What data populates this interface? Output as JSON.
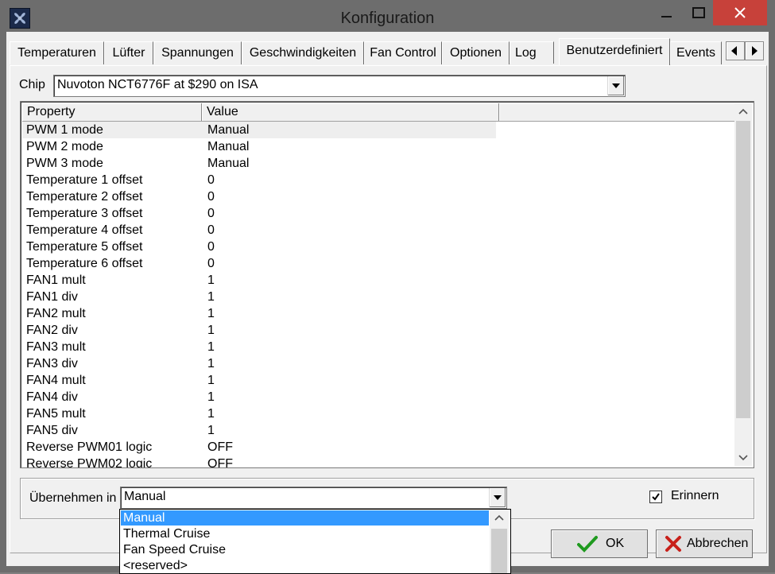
{
  "window": {
    "title": "Konfiguration",
    "close_color": "#c7413a"
  },
  "tabs": [
    {
      "label": "Temperaturen"
    },
    {
      "label": "Lüfter"
    },
    {
      "label": "Spannungen"
    },
    {
      "label": "Geschwindigkeiten"
    },
    {
      "label": "Fan Control"
    },
    {
      "label": "Optionen"
    },
    {
      "label": "Log"
    },
    {
      "label": "Benutzerdefiniert",
      "active": true
    },
    {
      "label": "Events"
    }
  ],
  "chip": {
    "label": "Chip",
    "value": "Nuvoton NCT6776F at $290 on ISA"
  },
  "grid": {
    "columns": [
      "Property",
      "Value"
    ],
    "rows": [
      {
        "property": "PWM 1 mode",
        "value": "Manual"
      },
      {
        "property": "PWM 2 mode",
        "value": "Manual"
      },
      {
        "property": "PWM 3 mode",
        "value": "Manual"
      },
      {
        "property": "Temperature 1 offset",
        "value": "0"
      },
      {
        "property": "Temperature 2 offset",
        "value": "0"
      },
      {
        "property": "Temperature 3 offset",
        "value": "0"
      },
      {
        "property": "Temperature 4 offset",
        "value": "0"
      },
      {
        "property": "Temperature 5 offset",
        "value": "0"
      },
      {
        "property": "Temperature 6 offset",
        "value": "0"
      },
      {
        "property": "FAN1 mult",
        "value": "1"
      },
      {
        "property": "FAN1 div",
        "value": "1"
      },
      {
        "property": "FAN2 mult",
        "value": "1"
      },
      {
        "property": "FAN2 div",
        "value": "1"
      },
      {
        "property": "FAN3 mult",
        "value": "1"
      },
      {
        "property": "FAN3 div",
        "value": "1"
      },
      {
        "property": "FAN4 mult",
        "value": "1"
      },
      {
        "property": "FAN4 div",
        "value": "1"
      },
      {
        "property": "FAN5 mult",
        "value": "1"
      },
      {
        "property": "FAN5 div",
        "value": "1"
      },
      {
        "property": "Reverse PWM01 logic",
        "value": "OFF"
      },
      {
        "property": "Reverse PWM02 logic",
        "value": "OFF"
      }
    ]
  },
  "apply": {
    "label": "Übernehmen in",
    "value": "Manual",
    "options": [
      "Manual",
      "Thermal Cruise",
      "Fan Speed Cruise",
      "<reserved>"
    ],
    "highlight_color": "#3399ff"
  },
  "remember": {
    "label": "Erinnern",
    "checked": true
  },
  "buttons": {
    "ok": "OK",
    "cancel": "Abbrechen"
  }
}
